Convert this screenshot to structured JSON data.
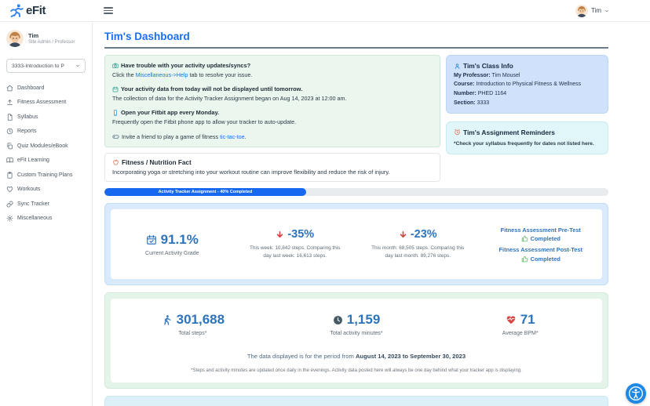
{
  "header": {
    "brand": "eFit",
    "user": {
      "name": "Tim"
    }
  },
  "sidebar": {
    "user_name": "Tim",
    "user_role": "Site Admin / Professor",
    "course_select": "3333-Introduction to P",
    "items": [
      {
        "label": "Dashboard",
        "icon": "home-icon"
      },
      {
        "label": "Fitness Assessment",
        "icon": "upload-icon"
      },
      {
        "label": "Syllabus",
        "icon": "document-icon"
      },
      {
        "label": "Reports",
        "icon": "clock-icon"
      },
      {
        "label": "Quiz Modules/eBook",
        "icon": "pages-icon"
      },
      {
        "label": "eFit Learning",
        "icon": "open-book-icon"
      },
      {
        "label": "Custom Training Plans",
        "icon": "clipboard-icon"
      },
      {
        "label": "Workouts",
        "icon": "heart-icon"
      },
      {
        "label": "Sync Tracker",
        "icon": "link-icon"
      },
      {
        "label": "Miscellaneous",
        "icon": "gear-icon"
      }
    ]
  },
  "main": {
    "title": "Tim's Dashboard",
    "notices": [
      {
        "title": "Have trouble with your activity updates/syncs?",
        "body_prefix": "Click the ",
        "link": "Miscellaneous->Help",
        "body_suffix": " tab to resolve your issue."
      },
      {
        "title": "Your activity data from today will not be displayed until tomorrow.",
        "body_prefix": "The collection of data for the Activity Tracker Assignment began on Aug 14, 2023 at 12:00 am.",
        "link": "",
        "body_suffix": ""
      },
      {
        "title": "Open your Fitbit app every Monday.",
        "body_prefix": "Frequently open the Fitbit phone app to allow your tracker to auto-update.",
        "link": "",
        "body_suffix": ""
      },
      {
        "body_prefix": "Invite a friend to play a game of fitness ",
        "link": "tic-tac-toe",
        "body_suffix": "."
      }
    ],
    "fact": {
      "title": "Fitness / Nutrition Fact",
      "body": "Incorporating yoga or stretching into your workout routine can improve flexibility and reduce the risk of injury."
    },
    "class_info": {
      "title": "Tim's Class Info",
      "rows": [
        {
          "label": "My Professor:",
          "value": "Tim Mousel"
        },
        {
          "label": "Course:",
          "value": "Introduction to Physical Fitness & Wellness"
        },
        {
          "label": "Number:",
          "value": "PHED 1164"
        },
        {
          "label": "Section:",
          "value": "3333"
        }
      ]
    },
    "reminders": {
      "title": "Tim's Assignment Reminders",
      "note": "*Check your syllabus frequently for dates not listed here."
    },
    "progress": {
      "label": "Activity Tracker Assignment - 40% Completed",
      "percent": 40
    },
    "card1": {
      "activity_grade": {
        "value": "91.1%",
        "label": "Current Activity Grade"
      },
      "weekly": {
        "value": "-35%",
        "caption": "This week: 10,842 steps. Comparing this day last week: 16,613 steps."
      },
      "monthly": {
        "value": "-23%",
        "caption": "This month: 68,505 steps. Comparing this day last month: 89,276 steps."
      },
      "tests": [
        {
          "name": "Fitness Assessment Pre-Test",
          "status": "Completed"
        },
        {
          "name": "Fitness Assessment Post-Test",
          "status": "Completed"
        }
      ]
    },
    "card2": {
      "steps": {
        "value": "301,688",
        "label": "Total steps*"
      },
      "minutes": {
        "value": "1,159",
        "label": "Total activity minutes*"
      },
      "bpm": {
        "value": "71",
        "label": "Average BPM*"
      },
      "period_prefix": "The data displayed is for the period from ",
      "period_dates": "August 14, 2023 to September 30, 2023",
      "footnote": "*Steps and activity minutes are updated once daily in the evenings. Activity data posted here will always be one day behind what your tracker app is displaying."
    }
  },
  "colors": {
    "accent_blue": "#1b6ff2",
    "link_blue": "#1a73e8",
    "stat_blue": "#2e74ba",
    "alert_red": "#d64541",
    "success_green": "#5cb85c",
    "progress_blue": "#1668f0"
  }
}
